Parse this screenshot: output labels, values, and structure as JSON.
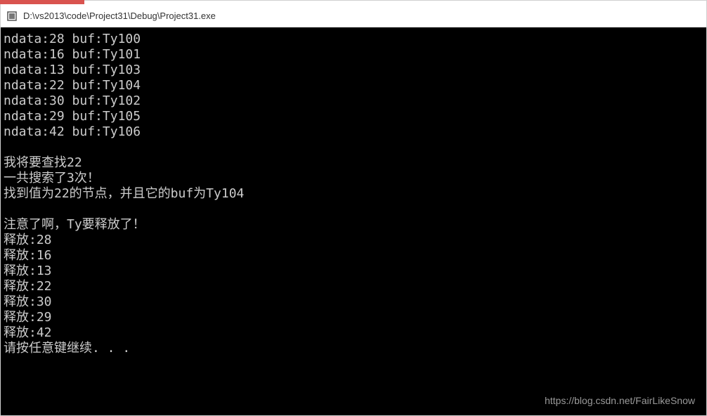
{
  "window": {
    "title": "D:\\vs2013\\code\\Project31\\Debug\\Project31.exe"
  },
  "console": {
    "lines": [
      "ndata:28 buf:Ty100",
      "ndata:16 buf:Ty101",
      "ndata:13 buf:Ty103",
      "ndata:22 buf:Ty104",
      "ndata:30 buf:Ty102",
      "ndata:29 buf:Ty105",
      "ndata:42 buf:Ty106",
      "",
      "我将要查找22",
      "一共搜索了3次！",
      "找到值为22的节点，并且它的buf为Ty104",
      "",
      "注意了啊，Ty要释放了！",
      "释放:28",
      "释放:16",
      "释放:13",
      "释放:22",
      "释放:30",
      "释放:29",
      "释放:42",
      "请按任意键继续. . ."
    ]
  },
  "watermark": {
    "text": "https://blog.csdn.net/FairLikeSnow"
  }
}
